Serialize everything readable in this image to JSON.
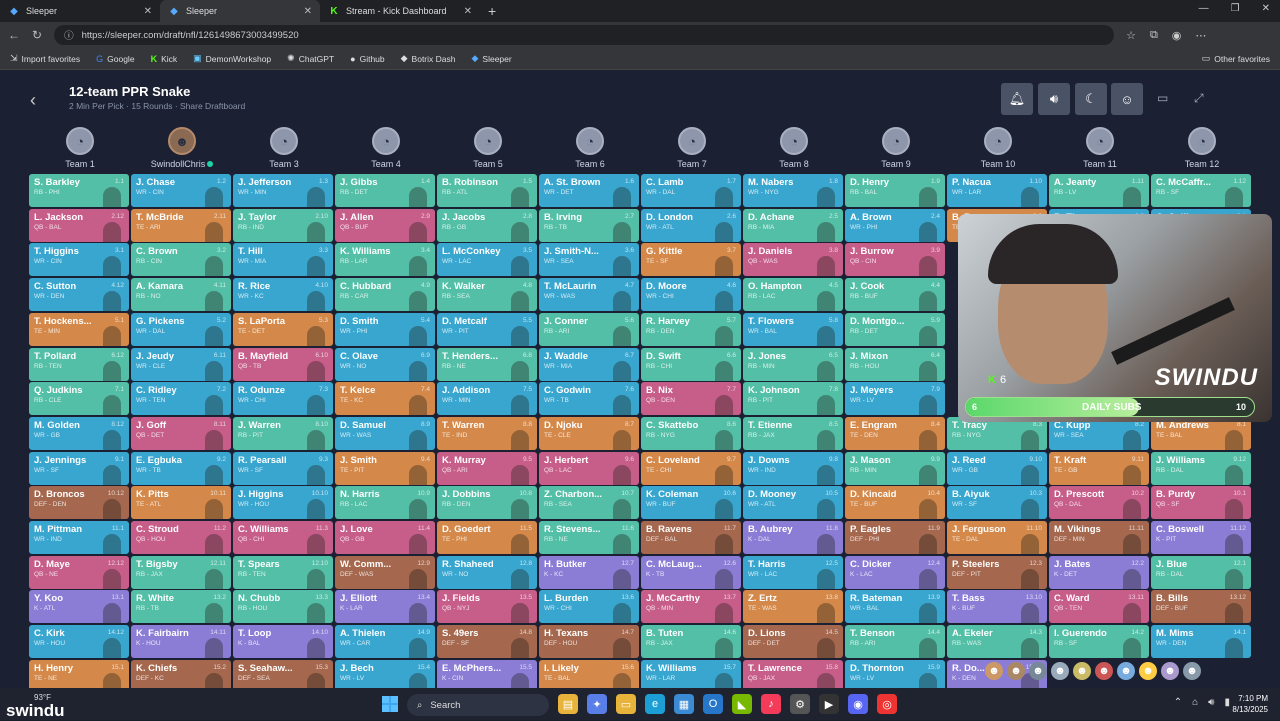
{
  "browser": {
    "tabs": [
      {
        "label": "Sleeper",
        "active": false,
        "icon": "sleeper-icon"
      },
      {
        "label": "Sleeper",
        "active": true,
        "icon": "sleeper-icon"
      },
      {
        "label": "Stream - Kick Dashboard",
        "active": false,
        "icon": "kick-icon"
      }
    ],
    "url": "https://sleeper.com/draft/nfl/1261498673003499520",
    "bookmarks": [
      "Import favorites",
      "Google",
      "Kick",
      "DemonWorkshop",
      "ChatGPT",
      "Github",
      "Botrix Dash",
      "Sleeper"
    ],
    "other_favorites": "Other favorites"
  },
  "draft": {
    "title": "12-team PPR Snake",
    "subtitle": "2 Min Per Pick · 15 Rounds · Share Draftboard",
    "teams": [
      "Team 1",
      "SwindollChris",
      "Team 3",
      "Team 4",
      "Team 5",
      "Team 6",
      "Team 7",
      "Team 8",
      "Team 9",
      "Team 10",
      "Team 11",
      "Team 12"
    ],
    "colors": {
      "RB": "#53bfa6",
      "WR": "#38a6cf",
      "TE": "#d4894a",
      "QB": "#c75e89",
      "K": "#8b7dd6",
      "DEF": "#a5684e"
    },
    "rows": [
      [
        [
          "S. Barkley",
          "RB - PHI",
          "1.1"
        ],
        [
          "J. Chase",
          "WR - CIN",
          "1.2"
        ],
        [
          "J. Jefferson",
          "WR - MIN",
          "1.3"
        ],
        [
          "J. Gibbs",
          "RB - DET",
          "1.4"
        ],
        [
          "B. Robinson",
          "RB - ATL",
          "1.5"
        ],
        [
          "A. St. Brown",
          "WR - DET",
          "1.6"
        ],
        [
          "C. Lamb",
          "WR - DAL",
          "1.7"
        ],
        [
          "M. Nabers",
          "WR - NYG",
          "1.8"
        ],
        [
          "D. Henry",
          "RB - BAL",
          "1.9"
        ],
        [
          "P. Nacua",
          "WR - LAR",
          "1.10"
        ],
        [
          "A. Jeanty",
          "RB - LV",
          "1.11"
        ],
        [
          "C. McCaffr...",
          "RB - SF",
          "1.12"
        ]
      ],
      [
        [
          "L. Jackson",
          "QB - BAL",
          "2.12"
        ],
        [
          "T. McBride",
          "TE - ARI",
          "2.11"
        ],
        [
          "J. Taylor",
          "RB - IND",
          "2.10"
        ],
        [
          "J. Allen",
          "QB - BUF",
          "2.9"
        ],
        [
          "J. Jacobs",
          "RB - GB",
          "2.8"
        ],
        [
          "B. Irving",
          "RB - TB",
          "2.7"
        ],
        [
          "D. London",
          "WR - ATL",
          "2.6"
        ],
        [
          "D. Achane",
          "RB - MIA",
          "2.5"
        ],
        [
          "A. Brown",
          "WR - PHI",
          "2.4"
        ],
        [
          "B. Bowers",
          "TE - LV",
          "2.3"
        ],
        [
          "B. Thomas",
          "WR - JAX",
          "2.2"
        ],
        [
          "C. Collins",
          "WR - HOU",
          "2.1"
        ]
      ],
      [
        [
          "T. Higgins",
          "WR - CIN",
          "3.1"
        ],
        [
          "C. Brown",
          "RB - CIN",
          "3.2"
        ],
        [
          "T. Hill",
          "WR - MIA",
          "3.3"
        ],
        [
          "K. Williams",
          "RB - LAR",
          "3.4"
        ],
        [
          "L. McConkey",
          "WR - LAC",
          "3.5"
        ],
        [
          "J. Smith-N...",
          "WR - SEA",
          "3.6"
        ],
        [
          "G. Kittle",
          "TE - SF",
          "3.7"
        ],
        [
          "J. Daniels",
          "QB - WAS",
          "3.8"
        ],
        [
          "J. Burrow",
          "QB - CIN",
          "3.9"
        ],
        [
          "",
          "",
          ""
        ],
        [
          "",
          "",
          ""
        ],
        [
          "",
          "",
          ""
        ]
      ],
      [
        [
          "C. Sutton",
          "WR - DEN",
          "4.12"
        ],
        [
          "A. Kamara",
          "RB - NO",
          "4.11"
        ],
        [
          "R. Rice",
          "WR - KC",
          "4.10"
        ],
        [
          "C. Hubbard",
          "RB - CAR",
          "4.9"
        ],
        [
          "K. Walker",
          "RB - SEA",
          "4.8"
        ],
        [
          "T. McLaurin",
          "WR - WAS",
          "4.7"
        ],
        [
          "D. Moore",
          "WR - CHI",
          "4.6"
        ],
        [
          "O. Hampton",
          "RB - LAC",
          "4.5"
        ],
        [
          "J. Cook",
          "RB - BUF",
          "4.4"
        ],
        [
          "",
          "",
          ""
        ],
        [
          "",
          "",
          ""
        ],
        [
          "",
          "",
          ""
        ]
      ],
      [
        [
          "T. Hockens...",
          "TE - MIN",
          "5.1"
        ],
        [
          "G. Pickens",
          "WR - DAL",
          "5.2"
        ],
        [
          "S. LaPorta",
          "TE - DET",
          "5.3"
        ],
        [
          "D. Smith",
          "WR - PHI",
          "5.4"
        ],
        [
          "D. Metcalf",
          "WR - PIT",
          "5.5"
        ],
        [
          "J. Conner",
          "RB - ARI",
          "5.6"
        ],
        [
          "R. Harvey",
          "RB - DEN",
          "5.7"
        ],
        [
          "T. Flowers",
          "WR - BAL",
          "5.8"
        ],
        [
          "D. Montgo...",
          "RB - DET",
          "5.9"
        ],
        [
          "",
          "",
          ""
        ],
        [
          "",
          "",
          ""
        ],
        [
          "",
          "",
          ""
        ]
      ],
      [
        [
          "T. Pollard",
          "RB - TEN",
          "6.12"
        ],
        [
          "J. Jeudy",
          "WR - CLE",
          "6.11"
        ],
        [
          "B. Mayfield",
          "QB - TB",
          "6.10"
        ],
        [
          "C. Olave",
          "WR - NO",
          "6.9"
        ],
        [
          "T. Henders...",
          "RB - NE",
          "6.8"
        ],
        [
          "J. Waddle",
          "WR - MIA",
          "6.7"
        ],
        [
          "D. Swift",
          "RB - CHI",
          "6.6"
        ],
        [
          "J. Jones",
          "RB - MIN",
          "6.5"
        ],
        [
          "J. Mixon",
          "RB - HOU",
          "6.4"
        ],
        [
          "",
          "",
          ""
        ],
        [
          "",
          "",
          ""
        ],
        [
          "",
          "",
          ""
        ]
      ],
      [
        [
          "Q. Judkins",
          "RB - CLE",
          "7.1"
        ],
        [
          "C. Ridley",
          "WR - TEN",
          "7.2"
        ],
        [
          "R. Odunze",
          "WR - CHI",
          "7.3"
        ],
        [
          "T. Kelce",
          "TE - KC",
          "7.4"
        ],
        [
          "J. Addison",
          "WR - MIN",
          "7.5"
        ],
        [
          "C. Godwin",
          "WR - TB",
          "7.6"
        ],
        [
          "B. Nix",
          "QB - DEN",
          "7.7"
        ],
        [
          "K. Johnson",
          "RB - PIT",
          "7.8"
        ],
        [
          "J. Meyers",
          "WR - LV",
          "7.9"
        ],
        [
          "",
          "",
          ""
        ],
        [
          "",
          "",
          ""
        ],
        [
          "",
          "",
          ""
        ]
      ],
      [
        [
          "M. Golden",
          "WR - GB",
          "8.12"
        ],
        [
          "J. Goff",
          "QB - DET",
          "8.11"
        ],
        [
          "J. Warren",
          "RB - PIT",
          "8.10"
        ],
        [
          "D. Samuel",
          "WR - WAS",
          "8.9"
        ],
        [
          "T. Warren",
          "TE - IND",
          "8.8"
        ],
        [
          "D. Njoku",
          "TE - CLE",
          "8.7"
        ],
        [
          "C. Skattebo",
          "RB - NYG",
          "8.6"
        ],
        [
          "T. Etienne",
          "RB - JAX",
          "8.5"
        ],
        [
          "E. Engram",
          "TE - DEN",
          "8.4"
        ],
        [
          "T. Tracy",
          "RB - NYG",
          "8.3"
        ],
        [
          "C. Kupp",
          "WR - SEA",
          "8.2"
        ],
        [
          "M. Andrews",
          "TE - BAL",
          "8.1"
        ]
      ],
      [
        [
          "J. Jennings",
          "WR - SF",
          "9.1"
        ],
        [
          "E. Egbuka",
          "WR - TB",
          "9.2"
        ],
        [
          "R. Pearsall",
          "WR - SF",
          "9.3"
        ],
        [
          "J. Smith",
          "TE - PIT",
          "9.4"
        ],
        [
          "K. Murray",
          "QB - ARI",
          "9.5"
        ],
        [
          "J. Herbert",
          "QB - LAC",
          "9.6"
        ],
        [
          "C. Loveland",
          "TE - CHI",
          "9.7"
        ],
        [
          "J. Downs",
          "WR - IND",
          "9.8"
        ],
        [
          "J. Mason",
          "RB - MIN",
          "9.9"
        ],
        [
          "J. Reed",
          "WR - GB",
          "9.10"
        ],
        [
          "T. Kraft",
          "TE - GB",
          "9.11"
        ],
        [
          "J. Williams",
          "RB - DAL",
          "9.12"
        ]
      ],
      [
        [
          "D. Broncos",
          "DEF - DEN",
          "10.12"
        ],
        [
          "K. Pitts",
          "TE - ATL",
          "10.11"
        ],
        [
          "J. Higgins",
          "WR - HOU",
          "10.10"
        ],
        [
          "N. Harris",
          "RB - LAC",
          "10.9"
        ],
        [
          "J. Dobbins",
          "RB - DEN",
          "10.8"
        ],
        [
          "Z. Charbon...",
          "RB - SEA",
          "10.7"
        ],
        [
          "K. Coleman",
          "WR - BUF",
          "10.6"
        ],
        [
          "D. Mooney",
          "WR - ATL",
          "10.5"
        ],
        [
          "D. Kincaid",
          "TE - BUF",
          "10.4"
        ],
        [
          "B. Aiyuk",
          "WR - SF",
          "10.3"
        ],
        [
          "D. Prescott",
          "QB - DAL",
          "10.2"
        ],
        [
          "B. Purdy",
          "QB - SF",
          "10.1"
        ]
      ],
      [
        [
          "M. Pittman",
          "WR - IND",
          "11.1"
        ],
        [
          "C. Stroud",
          "QB - HOU",
          "11.2"
        ],
        [
          "C. Williams",
          "QB - CHI",
          "11.3"
        ],
        [
          "J. Love",
          "QB - GB",
          "11.4"
        ],
        [
          "D. Goedert",
          "TE - PHI",
          "11.5"
        ],
        [
          "R. Stevens...",
          "RB - NE",
          "11.6"
        ],
        [
          "B. Ravens",
          "DEF - BAL",
          "11.7"
        ],
        [
          "B. Aubrey",
          "K - DAL",
          "11.8"
        ],
        [
          "P. Eagles",
          "DEF - PHI",
          "11.9"
        ],
        [
          "J. Ferguson",
          "TE - DAL",
          "11.10"
        ],
        [
          "M. Vikings",
          "DEF - MIN",
          "11.11"
        ],
        [
          "C. Boswell",
          "K - PIT",
          "11.12"
        ]
      ],
      [
        [
          "D. Maye",
          "QB - NE",
          "12.12"
        ],
        [
          "T. Bigsby",
          "RB - JAX",
          "12.11"
        ],
        [
          "T. Spears",
          "RB - TEN",
          "12.10"
        ],
        [
          "W. Comm...",
          "DEF - WAS",
          "12.9"
        ],
        [
          "R. Shaheed",
          "WR - NO",
          "12.8"
        ],
        [
          "H. Butker",
          "K - KC",
          "12.7"
        ],
        [
          "C. McLaug...",
          "K - TB",
          "12.6"
        ],
        [
          "T. Harris",
          "WR - LAC",
          "12.5"
        ],
        [
          "C. Dicker",
          "K - LAC",
          "12.4"
        ],
        [
          "P. Steelers",
          "DEF - PIT",
          "12.3"
        ],
        [
          "J. Bates",
          "K - DET",
          "12.2"
        ],
        [
          "J. Blue",
          "RB - DAL",
          "12.1"
        ]
      ],
      [
        [
          "Y. Koo",
          "K - ATL",
          "13.1"
        ],
        [
          "R. White",
          "RB - TB",
          "13.2"
        ],
        [
          "N. Chubb",
          "RB - HOU",
          "13.3"
        ],
        [
          "J. Elliott",
          "K - LAR",
          "13.4"
        ],
        [
          "J. Fields",
          "QB - NYJ",
          "13.5"
        ],
        [
          "L. Burden",
          "WR - CHI",
          "13.6"
        ],
        [
          "J. McCarthy",
          "QB - MIN",
          "13.7"
        ],
        [
          "Z. Ertz",
          "TE - WAS",
          "13.8"
        ],
        [
          "R. Bateman",
          "WR - BAL",
          "13.9"
        ],
        [
          "T. Bass",
          "K - BUF",
          "13.10"
        ],
        [
          "C. Ward",
          "QB - TEN",
          "13.11"
        ],
        [
          "B. Bills",
          "DEF - BUF",
          "13.12"
        ]
      ],
      [
        [
          "C. Kirk",
          "WR - HOU",
          "14.12"
        ],
        [
          "K. Fairbairn",
          "K - HOU",
          "14.11"
        ],
        [
          "T. Loop",
          "K - BAL",
          "14.10"
        ],
        [
          "A. Thielen",
          "WR - CAR",
          "14.9"
        ],
        [
          "S. 49ers",
          "DEF - SF",
          "14.8"
        ],
        [
          "H. Texans",
          "DEF - HOU",
          "14.7"
        ],
        [
          "B. Tuten",
          "RB - JAX",
          "14.6"
        ],
        [
          "D. Lions",
          "DEF - DET",
          "14.5"
        ],
        [
          "T. Benson",
          "RB - ARI",
          "14.4"
        ],
        [
          "A. Ekeler",
          "RB - WAS",
          "14.3"
        ],
        [
          "I. Guerendo",
          "RB - SF",
          "14.2"
        ],
        [
          "M. Mims",
          "WR - DEN",
          "14.1"
        ]
      ],
      [
        [
          "H. Henry",
          "TE - NE",
          "15.1"
        ],
        [
          "K. Chiefs",
          "DEF - KC",
          "15.2"
        ],
        [
          "S. Seahaw...",
          "DEF - SEA",
          "15.3"
        ],
        [
          "J. Bech",
          "WR - LV",
          "15.4"
        ],
        [
          "E. McPhers...",
          "K - CIN",
          "15.5"
        ],
        [
          "I. Likely",
          "TE - BAL",
          "15.6"
        ],
        [
          "K. Williams",
          "WR - LAR",
          "15.7"
        ],
        [
          "T. Lawrence",
          "QB - JAX",
          "15.8"
        ],
        [
          "D. Thornton",
          "WR - LV",
          "15.9"
        ],
        [
          "R. Do...",
          "K - DEN",
          "15.10"
        ],
        [
          "",
          "",
          ""
        ],
        [
          "",
          "",
          ""
        ]
      ]
    ]
  },
  "stream": {
    "brand": "SWINDU",
    "kick_count": "6",
    "subs_left": "6",
    "subs_label": "DAILY SUBS",
    "subs_right": "10",
    "subs_progress": 0.6
  },
  "taskbar": {
    "weather": "93°F",
    "watermark": "swindu",
    "search": "Search",
    "time": "7:10 PM",
    "date": "8/13/2025"
  }
}
